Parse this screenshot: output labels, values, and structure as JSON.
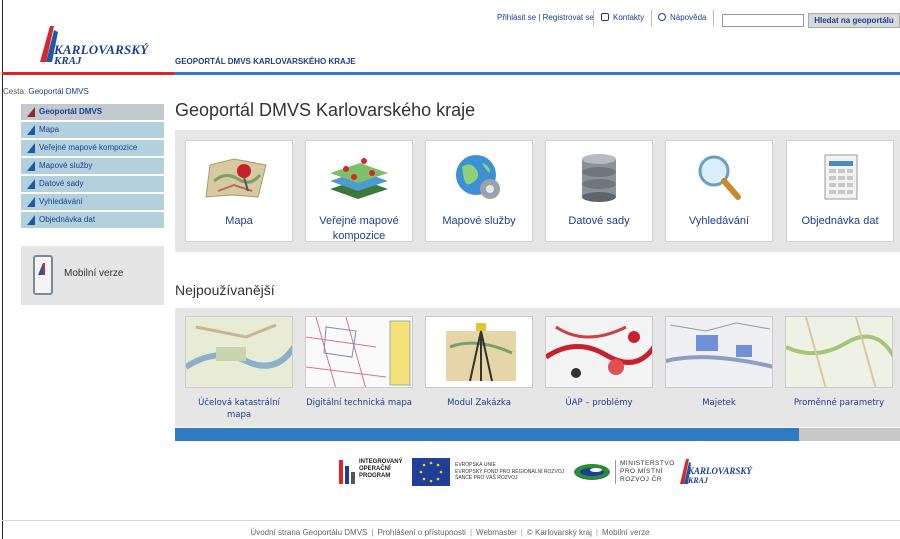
{
  "header": {
    "logo_line1": "KARLOVARSKÝ",
    "logo_line2": "KRAJ",
    "portal_title": "GEOPORTÁL DMVS KARLOVARSKÉHO KRAJE",
    "login_links": "Přihlásit se | Registrovat se",
    "contacts": "Kontakty",
    "help": "Nápověda",
    "search_placeholder": "",
    "search_button": "Hledat na geoportálu"
  },
  "breadcrumb": {
    "label": "Cesta:",
    "current": "Geoportál DMVS"
  },
  "sidebar": {
    "items": [
      {
        "label": "Geoportál DMVS",
        "active": true
      },
      {
        "label": "Mapa"
      },
      {
        "label": "Veřejné mapové kompozice"
      },
      {
        "label": "Mapové služby"
      },
      {
        "label": "Datové sady"
      },
      {
        "label": "Vyhledávání"
      },
      {
        "label": "Objednávka dat"
      }
    ],
    "mobile": "Mobilní verze"
  },
  "main": {
    "title": "Geoportál DMVS Karlovarského kraje",
    "tiles": [
      {
        "label": "Mapa",
        "icon": "map-pin-icon"
      },
      {
        "label": "Veřejné mapové kompozice",
        "icon": "map-layers-icon"
      },
      {
        "label": "Mapové služby",
        "icon": "globe-gear-icon"
      },
      {
        "label": "Datové sady",
        "icon": "database-icon"
      },
      {
        "label": "Vyhledávání",
        "icon": "magnifier-icon"
      },
      {
        "label": "Objednávka dat",
        "icon": "spreadsheet-icon"
      }
    ],
    "most_used_title": "Nejpoužívanější",
    "most_used": [
      {
        "label": "Účelová katastrální mapa"
      },
      {
        "label": "Digitální technická mapa"
      },
      {
        "label": "Modul Zakázka"
      },
      {
        "label": "ÚAP – problémy"
      },
      {
        "label": "Majetek"
      },
      {
        "label": "Proměnné parametry"
      }
    ],
    "carousel_progress": 0.86
  },
  "sponsors": {
    "iop": [
      "INTEGROVANÝ",
      "OPERAČNÍ",
      "PROGRAM"
    ],
    "eu": [
      "EVROPSKÁ UNIE",
      "EVROPSKÝ FOND PRO REGIONÁLNÍ ROZVOJ",
      "ŠANCE PRO VÁŠ ROZVOJ"
    ],
    "mmr": [
      "MINISTERSTVO",
      "PRO MÍSTNÍ",
      "ROZVOJ ČR"
    ],
    "kraj": [
      "KARLOVARSKÝ",
      "KRAJ"
    ]
  },
  "footer": {
    "links": [
      "Úvodní strana Geoportálu DMVS",
      "Prohlášení o přístupnosti",
      "Webmaster",
      "© Karlovarský kraj",
      "Mobilní verze"
    ]
  },
  "colors": {
    "brand_blue": "#1a3f8f",
    "accent_red": "#d9262a",
    "bar_blue": "#2d7bc2"
  }
}
